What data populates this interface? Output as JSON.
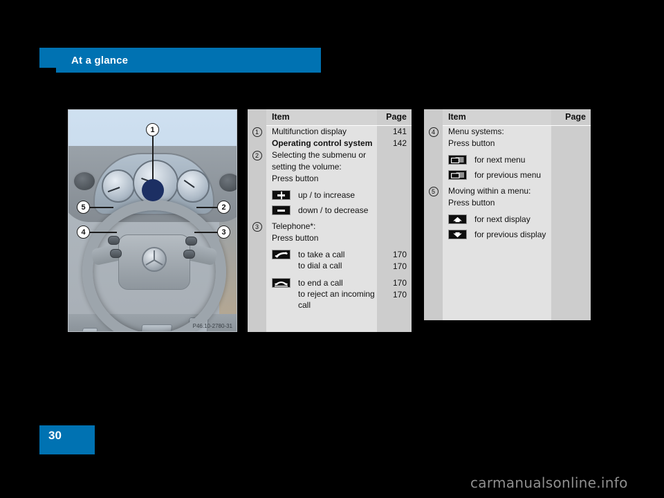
{
  "header": {
    "title": "At a glance"
  },
  "figure": {
    "caption": "P46.10-2780-31",
    "callouts": [
      "1",
      "2",
      "3",
      "4",
      "5"
    ]
  },
  "tables": [
    {
      "id": "table-left",
      "columns": {
        "item": "Item",
        "page": "Page"
      },
      "rows": [
        {
          "num": "1",
          "text": "Multifunction display",
          "page": "141",
          "bold": false
        },
        {
          "num": "",
          "text": "Operating control system",
          "page": "142",
          "bold": true
        },
        {
          "num": "2",
          "text": "Selecting the submenu or",
          "page": "",
          "bold": false
        },
        {
          "num": "",
          "text": "setting the volume:",
          "page": "",
          "bold": false
        },
        {
          "num": "",
          "text": "Press button",
          "page": "",
          "bold": false
        }
      ],
      "icon_rows_a": [
        {
          "icon": "plus-button-icon",
          "glyph": "plus",
          "label": "up / to increase",
          "page": ""
        },
        {
          "icon": "minus-button-icon",
          "glyph": "minus",
          "label": "down / to decrease",
          "page": ""
        }
      ],
      "rows_b": [
        {
          "num": "3",
          "text": "Telephone*:",
          "page": "",
          "bold": false
        },
        {
          "num": "",
          "text": "Press button",
          "page": "",
          "bold": false
        }
      ],
      "icon_rows_b": [
        {
          "icon": "phone-offhook-icon",
          "glyph": "phone-up",
          "labels": [
            "to take a call",
            "to dial a call"
          ],
          "pages": [
            "170",
            "170"
          ]
        },
        {
          "icon": "phone-onhook-icon",
          "glyph": "phone-down",
          "labels": [
            "to end a call",
            "to reject an incoming",
            "call"
          ],
          "pages": [
            "170",
            "170",
            ""
          ]
        }
      ]
    },
    {
      "id": "table-right",
      "columns": {
        "item": "Item",
        "page": "Page"
      },
      "rows": [
        {
          "num": "4",
          "text": "Menu systems:",
          "page": "",
          "bold": false
        },
        {
          "num": "",
          "text": "Press button",
          "page": "",
          "bold": false
        }
      ],
      "icon_rows_a": [
        {
          "icon": "next-menu-icon",
          "glyph": "win-right",
          "label": "for next menu",
          "page": ""
        },
        {
          "icon": "previous-menu-icon",
          "glyph": "win-left",
          "label": "for previous menu",
          "page": ""
        }
      ],
      "rows_b": [
        {
          "num": "5",
          "text": "Moving within a menu:",
          "page": "",
          "bold": false
        },
        {
          "num": "",
          "text": "Press button",
          "page": "",
          "bold": false
        }
      ],
      "icon_rows_b2": [
        {
          "icon": "arrow-up-icon",
          "glyph": "arr-up",
          "label": "for next display",
          "page": ""
        },
        {
          "icon": "arrow-down-icon",
          "glyph": "arr-down",
          "label": "for previous display",
          "page": ""
        }
      ]
    }
  ],
  "footer": {
    "page_number": "30",
    "watermark": "carmanualsonline.info"
  },
  "colors": {
    "brand_blue": "#0072b2",
    "table_gutter": "#cbcbcb",
    "table_body": "#e2e2e2",
    "page_column": "#cdcdcd",
    "marker_navy": "#1c2f63"
  }
}
